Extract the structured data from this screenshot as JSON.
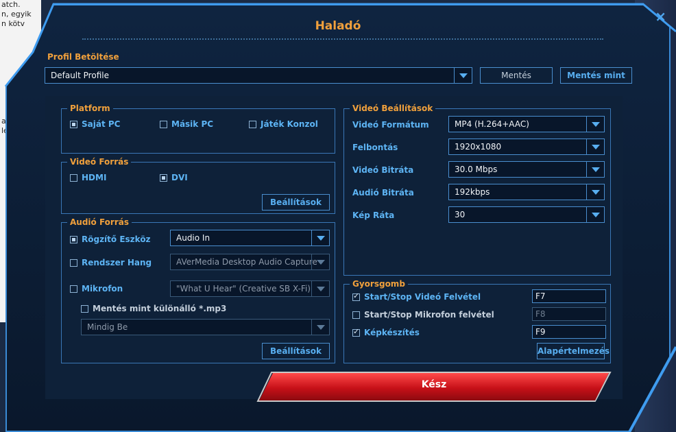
{
  "background_snippets": [
    "atch.",
    "n, egyik",
    "n kötv",
    "a",
    "le"
  ],
  "dialog": {
    "title": "Haladó",
    "close_symbol": "×"
  },
  "profile": {
    "label": "Profil Betöltése",
    "selected": "Default Profile",
    "save_label": "Mentés",
    "save_as_label": "Mentés mint"
  },
  "platform": {
    "title": "Platform",
    "options": [
      {
        "label": "Saját PC",
        "checked": true
      },
      {
        "label": "Másik PC",
        "checked": false
      },
      {
        "label": "Játék Konzol",
        "checked": false
      }
    ]
  },
  "video_source": {
    "title": "Videó Forrás",
    "options": [
      {
        "label": "HDMI",
        "checked": false
      },
      {
        "label": "DVI",
        "checked": true
      }
    ],
    "settings_label": "Beállítások"
  },
  "audio_source": {
    "title": "Audió Forrás",
    "rows": [
      {
        "label": "Rögzítő Eszköz",
        "checked": true,
        "value": "Audio In",
        "enabled": true
      },
      {
        "label": "Rendszer Hang",
        "checked": false,
        "value": "AVerMedia Desktop Audio Capture",
        "enabled": false
      },
      {
        "label": "Mikrofon",
        "checked": false,
        "value": "\"What U Hear\" (Creative SB X-Fi)",
        "enabled": false
      }
    ],
    "save_mp3_label": "Mentés mint különálló *.mp3",
    "mp3_mode": "Mindig Be",
    "settings_label": "Beállítások"
  },
  "video_settings": {
    "title": "Videó Beállítások",
    "rows": [
      {
        "label": "Videó Formátum",
        "value": "MP4 (H.264+AAC)"
      },
      {
        "label": "Felbontás",
        "value": "1920x1080"
      },
      {
        "label": "Videó Bitráta",
        "value": "30.0 Mbps"
      },
      {
        "label": "Audió Bitráta",
        "value": "192kbps"
      },
      {
        "label": "Kép Ráta",
        "value": "30"
      }
    ]
  },
  "hotkeys": {
    "title": "Gyorsgomb",
    "rows": [
      {
        "label": "Start/Stop Videó Felvétel",
        "checked": true,
        "key": "F7"
      },
      {
        "label": "Start/Stop Mikrofon felvétel",
        "checked": false,
        "key": "F8"
      },
      {
        "label": "Képkészítés",
        "checked": true,
        "key": "F9"
      }
    ],
    "default_label": "Alapértelmezés"
  },
  "done_label": "Kész",
  "colors": {
    "accent": "#f0a03c",
    "link": "#5db4f4",
    "frame": "#3a8bd6",
    "done": "#c71018"
  }
}
